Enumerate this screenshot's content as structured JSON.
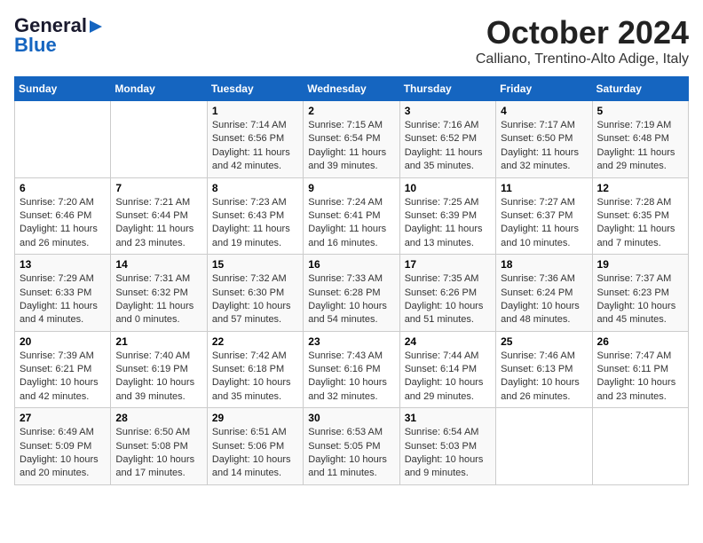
{
  "header": {
    "logo_line1": "General",
    "logo_line2": "Blue",
    "month": "October 2024",
    "location": "Calliano, Trentino-Alto Adige, Italy"
  },
  "days_of_week": [
    "Sunday",
    "Monday",
    "Tuesday",
    "Wednesday",
    "Thursday",
    "Friday",
    "Saturday"
  ],
  "weeks": [
    [
      {
        "day": "",
        "info": ""
      },
      {
        "day": "",
        "info": ""
      },
      {
        "day": "1",
        "info": "Sunrise: 7:14 AM\nSunset: 6:56 PM\nDaylight: 11 hours and 42 minutes."
      },
      {
        "day": "2",
        "info": "Sunrise: 7:15 AM\nSunset: 6:54 PM\nDaylight: 11 hours and 39 minutes."
      },
      {
        "day": "3",
        "info": "Sunrise: 7:16 AM\nSunset: 6:52 PM\nDaylight: 11 hours and 35 minutes."
      },
      {
        "day": "4",
        "info": "Sunrise: 7:17 AM\nSunset: 6:50 PM\nDaylight: 11 hours and 32 minutes."
      },
      {
        "day": "5",
        "info": "Sunrise: 7:19 AM\nSunset: 6:48 PM\nDaylight: 11 hours and 29 minutes."
      }
    ],
    [
      {
        "day": "6",
        "info": "Sunrise: 7:20 AM\nSunset: 6:46 PM\nDaylight: 11 hours and 26 minutes."
      },
      {
        "day": "7",
        "info": "Sunrise: 7:21 AM\nSunset: 6:44 PM\nDaylight: 11 hours and 23 minutes."
      },
      {
        "day": "8",
        "info": "Sunrise: 7:23 AM\nSunset: 6:43 PM\nDaylight: 11 hours and 19 minutes."
      },
      {
        "day": "9",
        "info": "Sunrise: 7:24 AM\nSunset: 6:41 PM\nDaylight: 11 hours and 16 minutes."
      },
      {
        "day": "10",
        "info": "Sunrise: 7:25 AM\nSunset: 6:39 PM\nDaylight: 11 hours and 13 minutes."
      },
      {
        "day": "11",
        "info": "Sunrise: 7:27 AM\nSunset: 6:37 PM\nDaylight: 11 hours and 10 minutes."
      },
      {
        "day": "12",
        "info": "Sunrise: 7:28 AM\nSunset: 6:35 PM\nDaylight: 11 hours and 7 minutes."
      }
    ],
    [
      {
        "day": "13",
        "info": "Sunrise: 7:29 AM\nSunset: 6:33 PM\nDaylight: 11 hours and 4 minutes."
      },
      {
        "day": "14",
        "info": "Sunrise: 7:31 AM\nSunset: 6:32 PM\nDaylight: 11 hours and 0 minutes."
      },
      {
        "day": "15",
        "info": "Sunrise: 7:32 AM\nSunset: 6:30 PM\nDaylight: 10 hours and 57 minutes."
      },
      {
        "day": "16",
        "info": "Sunrise: 7:33 AM\nSunset: 6:28 PM\nDaylight: 10 hours and 54 minutes."
      },
      {
        "day": "17",
        "info": "Sunrise: 7:35 AM\nSunset: 6:26 PM\nDaylight: 10 hours and 51 minutes."
      },
      {
        "day": "18",
        "info": "Sunrise: 7:36 AM\nSunset: 6:24 PM\nDaylight: 10 hours and 48 minutes."
      },
      {
        "day": "19",
        "info": "Sunrise: 7:37 AM\nSunset: 6:23 PM\nDaylight: 10 hours and 45 minutes."
      }
    ],
    [
      {
        "day": "20",
        "info": "Sunrise: 7:39 AM\nSunset: 6:21 PM\nDaylight: 10 hours and 42 minutes."
      },
      {
        "day": "21",
        "info": "Sunrise: 7:40 AM\nSunset: 6:19 PM\nDaylight: 10 hours and 39 minutes."
      },
      {
        "day": "22",
        "info": "Sunrise: 7:42 AM\nSunset: 6:18 PM\nDaylight: 10 hours and 35 minutes."
      },
      {
        "day": "23",
        "info": "Sunrise: 7:43 AM\nSunset: 6:16 PM\nDaylight: 10 hours and 32 minutes."
      },
      {
        "day": "24",
        "info": "Sunrise: 7:44 AM\nSunset: 6:14 PM\nDaylight: 10 hours and 29 minutes."
      },
      {
        "day": "25",
        "info": "Sunrise: 7:46 AM\nSunset: 6:13 PM\nDaylight: 10 hours and 26 minutes."
      },
      {
        "day": "26",
        "info": "Sunrise: 7:47 AM\nSunset: 6:11 PM\nDaylight: 10 hours and 23 minutes."
      }
    ],
    [
      {
        "day": "27",
        "info": "Sunrise: 6:49 AM\nSunset: 5:09 PM\nDaylight: 10 hours and 20 minutes."
      },
      {
        "day": "28",
        "info": "Sunrise: 6:50 AM\nSunset: 5:08 PM\nDaylight: 10 hours and 17 minutes."
      },
      {
        "day": "29",
        "info": "Sunrise: 6:51 AM\nSunset: 5:06 PM\nDaylight: 10 hours and 14 minutes."
      },
      {
        "day": "30",
        "info": "Sunrise: 6:53 AM\nSunset: 5:05 PM\nDaylight: 10 hours and 11 minutes."
      },
      {
        "day": "31",
        "info": "Sunrise: 6:54 AM\nSunset: 5:03 PM\nDaylight: 10 hours and 9 minutes."
      },
      {
        "day": "",
        "info": ""
      },
      {
        "day": "",
        "info": ""
      }
    ]
  ]
}
